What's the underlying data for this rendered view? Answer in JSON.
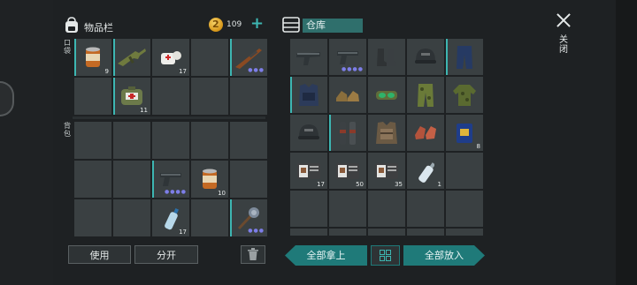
{
  "inventory": {
    "title": "物品栏",
    "pocket_label": "口袋",
    "backpack_label": "背包",
    "icon": "backpack-icon",
    "pocket_slots": [
      {
        "icon": "canned-food-icon",
        "qty": "9",
        "dots": "",
        "selected": true
      },
      {
        "icon": "assault-rifle-icon",
        "qty": "",
        "dots": "",
        "selected": true
      },
      {
        "icon": "bandage-icon",
        "qty": "17",
        "dots": "",
        "selected": false
      },
      {
        "icon": "",
        "qty": "",
        "dots": "",
        "selected": false
      },
      {
        "icon": "rifle-icon",
        "qty": "",
        "dots": "●●●",
        "selected": true
      },
      {
        "icon": "",
        "qty": "",
        "dots": "",
        "selected": false
      },
      {
        "icon": "medkit-icon",
        "qty": "11",
        "dots": "",
        "selected": true
      },
      {
        "icon": "",
        "qty": "",
        "dots": "",
        "selected": false
      },
      {
        "icon": "",
        "qty": "",
        "dots": "",
        "selected": false
      },
      {
        "icon": "",
        "qty": "",
        "dots": "",
        "selected": false
      }
    ],
    "backpack_slots": [
      {
        "icon": "",
        "qty": "",
        "dots": "",
        "selected": false
      },
      {
        "icon": "",
        "qty": "",
        "dots": "",
        "selected": false
      },
      {
        "icon": "",
        "qty": "",
        "dots": "",
        "selected": false
      },
      {
        "icon": "",
        "qty": "",
        "dots": "",
        "selected": false
      },
      {
        "icon": "",
        "qty": "",
        "dots": "",
        "selected": false
      },
      {
        "icon": "",
        "qty": "",
        "dots": "",
        "selected": false
      },
      {
        "icon": "",
        "qty": "",
        "dots": "",
        "selected": false
      },
      {
        "icon": "pistol-icon",
        "qty": "",
        "dots": "●●●●",
        "selected": true
      },
      {
        "icon": "canned-food-icon",
        "qty": "10",
        "dots": "",
        "selected": false
      },
      {
        "icon": "",
        "qty": "",
        "dots": "",
        "selected": false
      },
      {
        "icon": "",
        "qty": "",
        "dots": "",
        "selected": false
      },
      {
        "icon": "",
        "qty": "",
        "dots": "",
        "selected": false
      },
      {
        "icon": "water-bottle-icon",
        "qty": "17",
        "dots": "",
        "selected": false
      },
      {
        "icon": "",
        "qty": "",
        "dots": "",
        "selected": false
      },
      {
        "icon": "spiked-mace-icon",
        "qty": "",
        "dots": "●●●",
        "selected": true
      }
    ],
    "use_label": "使用",
    "split_label": "分开"
  },
  "currency": {
    "amount": "109",
    "icon": "gold-coin-icon",
    "add_icon": "plus-icon"
  },
  "warehouse": {
    "title": "仓库",
    "icon": "warehouse-icon",
    "slots": [
      {
        "icon": "smg-icon",
        "qty": "",
        "dots": "",
        "selected": false
      },
      {
        "icon": "pistol-icon",
        "qty": "",
        "dots": "●●●●",
        "selected": false
      },
      {
        "icon": "boots-icon",
        "qty": "",
        "dots": "",
        "selected": false
      },
      {
        "icon": "helmet-icon",
        "qty": "",
        "dots": "",
        "selected": false
      },
      {
        "icon": "pants-icon",
        "qty": "",
        "dots": "",
        "selected": true
      },
      {
        "icon": "armor-vest-icon",
        "qty": "",
        "dots": "",
        "selected": true
      },
      {
        "icon": "shoes-icon",
        "qty": "",
        "dots": "",
        "selected": false
      },
      {
        "icon": "goggles-icon",
        "qty": "",
        "dots": "",
        "selected": false
      },
      {
        "icon": "camo-pants-icon",
        "qty": "",
        "dots": "",
        "selected": false
      },
      {
        "icon": "camo-jacket-icon",
        "qty": "",
        "dots": "",
        "selected": false
      },
      {
        "icon": "helmet-icon",
        "qty": "",
        "dots": "",
        "selected": false
      },
      {
        "icon": "leg-armor-icon",
        "qty": "",
        "dots": "",
        "selected": true
      },
      {
        "icon": "body-armor-icon",
        "qty": "",
        "dots": "",
        "selected": false
      },
      {
        "icon": "gloves-icon",
        "qty": "",
        "dots": "",
        "selected": false
      },
      {
        "icon": "book-icon",
        "qty": "8",
        "dots": "",
        "selected": false
      },
      {
        "icon": "recipe-icon",
        "qty": "17",
        "dots": "",
        "selected": false
      },
      {
        "icon": "recipe-icon",
        "qty": "50",
        "dots": "",
        "selected": false
      },
      {
        "icon": "recipe-icon",
        "qty": "35",
        "dots": "",
        "selected": false
      },
      {
        "icon": "empty-bottle-icon",
        "qty": "1",
        "dots": "",
        "selected": false
      },
      {
        "icon": "",
        "qty": "",
        "dots": "",
        "selected": false
      },
      {
        "icon": "",
        "qty": "",
        "dots": "",
        "selected": false
      },
      {
        "icon": "",
        "qty": "",
        "dots": "",
        "selected": false
      },
      {
        "icon": "",
        "qty": "",
        "dots": "",
        "selected": false
      },
      {
        "icon": "",
        "qty": "",
        "dots": "",
        "selected": false
      },
      {
        "icon": "",
        "qty": "",
        "dots": "",
        "selected": false
      },
      {
        "icon": "",
        "qty": "",
        "dots": "",
        "selected": false
      },
      {
        "icon": "",
        "qty": "",
        "dots": "",
        "selected": false
      },
      {
        "icon": "",
        "qty": "",
        "dots": "",
        "selected": false
      },
      {
        "icon": "",
        "qty": "",
        "dots": "",
        "selected": false
      },
      {
        "icon": "",
        "qty": "",
        "dots": "",
        "selected": false
      }
    ],
    "take_all_label": "全部拿上",
    "put_all_label": "全部放入",
    "sort_icon": "grid-sort-icon"
  },
  "close": {
    "label": "关闭",
    "icon": "close-icon"
  },
  "colors": {
    "accent": "#3db6b2",
    "panel": "#1e2123",
    "slot": "#3a4042",
    "button_teal": "#1f7a79"
  }
}
